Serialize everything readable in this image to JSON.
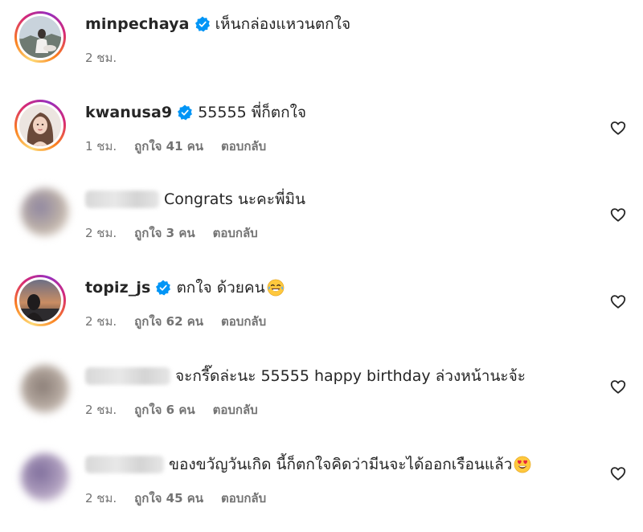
{
  "comments": [
    {
      "username": "minpechaya",
      "verified": true,
      "name_blurred": false,
      "text": "เห็นกล่องแหวนตกใจ",
      "time": "2 ชม.",
      "likes": "",
      "reply": "",
      "has_heart": false
    },
    {
      "username": "kwanusa9",
      "verified": true,
      "name_blurred": false,
      "text": "55555 พี่ก็ตกใจ",
      "time": "1 ชม.",
      "likes": "ถูกใจ 41 คน",
      "reply": "ตอบกลับ",
      "has_heart": true
    },
    {
      "username": "",
      "verified": false,
      "name_blurred": true,
      "text": "Congrats นะคะพี่มิน",
      "time": "2 ชม.",
      "likes": "ถูกใจ 3 คน",
      "reply": "ตอบกลับ",
      "has_heart": true
    },
    {
      "username": "topiz_js",
      "verified": true,
      "name_blurred": false,
      "text": "ตกใจ ด้วยคน",
      "emoji": "laughing-crying-emoji",
      "time": "2 ชม.",
      "likes": "ถูกใจ 62 คน",
      "reply": "ตอบกลับ",
      "has_heart": true
    },
    {
      "username": "",
      "verified": false,
      "name_blurred": true,
      "text": "จะกรี๊ดล่ะนะ 55555 happy birthday ล่วงหน้านะจ้ะ",
      "time": "2 ชม.",
      "likes": "ถูกใจ 6 คน",
      "reply": "ตอบกลับ",
      "has_heart": true
    },
    {
      "username": "",
      "verified": false,
      "name_blurred": true,
      "text": "ของขวัญวันเกิด นี้ก็ตกใจคิดว่ามีนจะได้ออกเรือนแล้ว",
      "emoji": "heart-eyes-emoji",
      "time": "2 ชม.",
      "likes": "ถูกใจ 45 คน",
      "reply": "ตอบกลับ",
      "has_heart": true
    }
  ],
  "colors": {
    "text": "#262626",
    "meta": "#737373",
    "verified": "#0095f6",
    "ring_gradient": [
      "#feda75",
      "#fa7e1e",
      "#d62976",
      "#962fbf"
    ]
  },
  "icons": {
    "verified": "verified-badge-icon",
    "like": "heart-outline-icon"
  }
}
